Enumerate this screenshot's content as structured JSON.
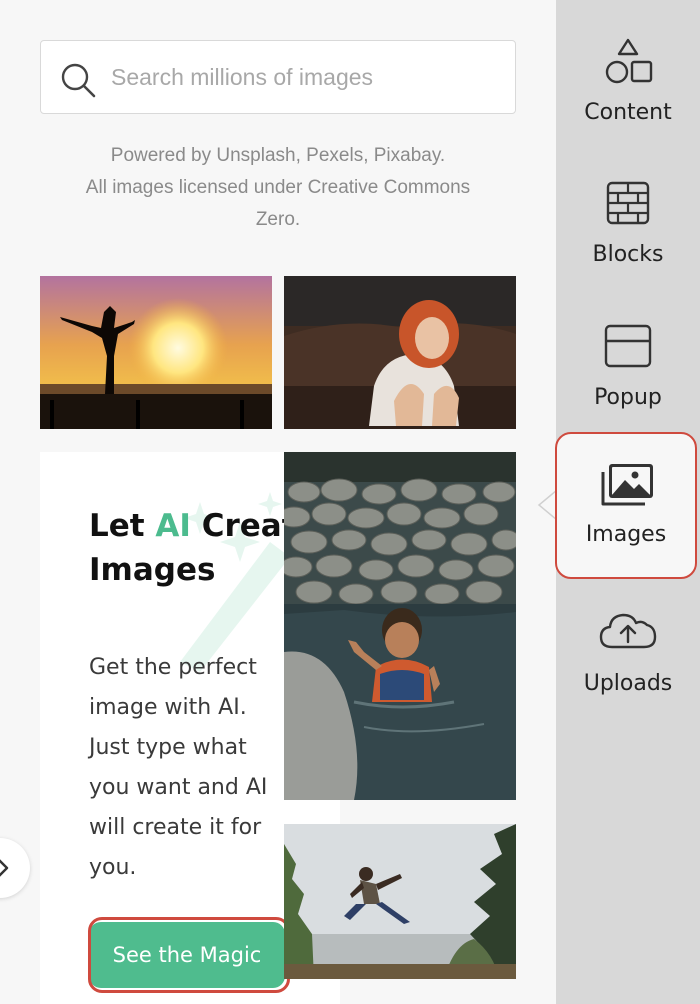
{
  "search": {
    "placeholder": "Search millions of images",
    "value": ""
  },
  "credits": {
    "line1": "Powered by Unsplash, Pexels, Pixabay.",
    "line2": "All images licensed under Creative Commons",
    "line3": "Zero."
  },
  "images": [
    {
      "subject": "woman silhouette on pier at sunset"
    },
    {
      "subject": "red-haired woman laughing on leather couch"
    },
    {
      "subject": "smiling child swimming near rocks"
    },
    {
      "subject": "person jumping in forest"
    }
  ],
  "ai_promo": {
    "title_word1": "Let",
    "title_accent": "AI",
    "title_rest": "Create Images",
    "body": "Get the perfect image with AI. Just type what you want and AI will create it for you.",
    "button": "See the Magic"
  },
  "sidebar": {
    "items": [
      {
        "label": "Content",
        "icon": "shapes-icon"
      },
      {
        "label": "Blocks",
        "icon": "brick-wall-icon"
      },
      {
        "label": "Popup",
        "icon": "popup-window-icon"
      },
      {
        "label": "Images",
        "icon": "image-gallery-icon",
        "active": true
      },
      {
        "label": "Uploads",
        "icon": "cloud-upload-icon"
      }
    ]
  },
  "colors": {
    "accent": "#4fbc8e",
    "highlight": "#cf4a3e",
    "sidebar_bg": "#d8d8d8"
  }
}
